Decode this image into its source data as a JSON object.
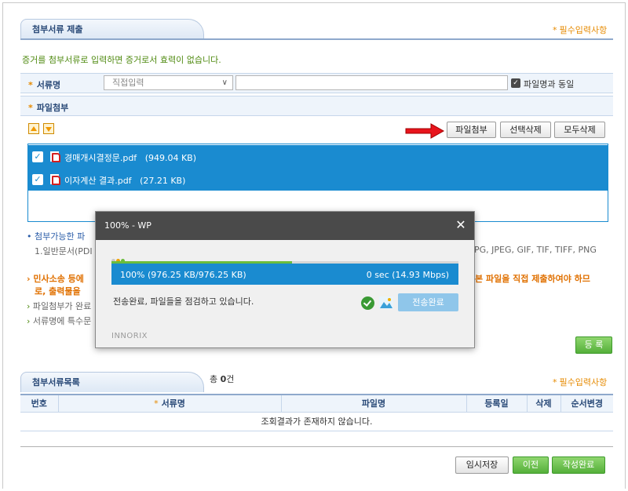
{
  "attach_section": {
    "title": "첨부서류 제출",
    "required_note": "필수입력사항",
    "notice": "증거를 첨부서류로 입력하면 증거로서 효력이 없습니다.",
    "doc_name_label": "서류명",
    "doc_select_value": "직접입력",
    "doc_input_value": "",
    "same_as_filename_label": "파일명과 동일",
    "file_attach_label": "파일첨부",
    "buttons": {
      "attach": "파일첨부",
      "delete_selected": "선택삭제",
      "delete_all": "모두삭제"
    },
    "files": [
      {
        "name": "경매개시결정문.pdf",
        "size": "(949.04 KB)"
      },
      {
        "name": "이자계산 결과.pdf",
        "size": "(27.21 KB)"
      }
    ],
    "allowed_label": "첨부가능한 파",
    "allowed_line1_left": "1.일반문서(PDI",
    "allowed_line1_right": "PG, JPEG, GIF, TIF, TIFF, PNG",
    "warn_line1_left": "민사소송 등에",
    "warn_line1_right": "본 파일을 직접 제출하여야 하므",
    "warn_line2": "로, 출력물을",
    "note1": "파일첨부가 완료",
    "note2": "서류명에 특수문",
    "register_button": "등 록"
  },
  "list_section": {
    "title": "첨부서류목록",
    "count_prefix": "총",
    "count_value": "0",
    "count_suffix": "건",
    "required_note": "필수입력사항",
    "columns": [
      "번호",
      "서류명",
      "파일명",
      "등록일",
      "삭제",
      "순서변경"
    ],
    "empty_message": "조회결과가 존재하지 않습니다."
  },
  "footer_buttons": {
    "temp_save": "임시저장",
    "prev": "이전",
    "complete": "작성완료"
  },
  "modal": {
    "title": "100% - WP",
    "progress_percent": 100,
    "progress_label": "100% (976.25 KB/976.25 KB)",
    "speed_label": "0 sec (14.93 Mbps)",
    "status": "전송완료, 파일들을 점검하고 있습니다.",
    "complete_button": "전송완료",
    "brand": "INNORIX"
  },
  "colors": {
    "accent_blue": "#1a8bd0",
    "green": "#55b03a",
    "orange": "#e68a00"
  }
}
